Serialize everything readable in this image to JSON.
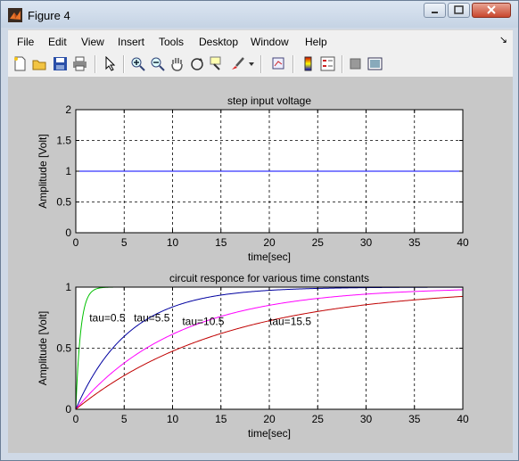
{
  "window": {
    "title": "Figure 4"
  },
  "menu": [
    "File",
    "Edit",
    "View",
    "Insert",
    "Tools",
    "Desktop",
    "Window",
    "Help"
  ],
  "toolbar_icons": [
    "new-figure-icon",
    "open-file-icon",
    "save-icon",
    "print-icon",
    "select-arrow-icon",
    "zoom-in-icon",
    "zoom-out-icon",
    "pan-hand-icon",
    "rotate-3d-icon",
    "data-cursor-icon",
    "brush-icon",
    "brush-dropdown-icon",
    "link-plot-icon",
    "colorbar-icon",
    "legend-icon",
    "hide-plot-tools-icon",
    "show-plot-tools-icon"
  ],
  "chart_data": [
    {
      "type": "line",
      "title": "step input voltage",
      "xlabel": "time[sec]",
      "ylabel": "Amplitude [Volt]",
      "xlim": [
        0,
        40
      ],
      "ylim": [
        0,
        2
      ],
      "xticks": [
        "0",
        "5",
        "10",
        "15",
        "20",
        "25",
        "30",
        "35",
        "40"
      ],
      "yticks": [
        "0",
        "0.5",
        "1",
        "1.5",
        "2"
      ],
      "grid": true,
      "series": [
        {
          "color": "#0000ff",
          "x": [
            0,
            40
          ],
          "y": [
            1,
            1
          ]
        }
      ]
    },
    {
      "type": "line",
      "title": "circuit responce for various time constants",
      "xlabel": "time[sec]",
      "ylabel": "Amplitude [Volt]",
      "xlim": [
        0,
        40
      ],
      "ylim": [
        0,
        1
      ],
      "xticks": [
        "0",
        "5",
        "10",
        "15",
        "20",
        "25",
        "30",
        "35",
        "40"
      ],
      "yticks": [
        "0",
        "0.5",
        "1"
      ],
      "grid": true,
      "series": [
        {
          "tau": 0.5,
          "color": "#00c000"
        },
        {
          "tau": 5.5,
          "color": "#0000a0"
        },
        {
          "tau": 10.5,
          "color": "#ff00ff"
        },
        {
          "tau": 15.5,
          "color": "#c00000"
        }
      ],
      "annotations": [
        {
          "text": "tau=0.5",
          "x": 1.4,
          "y": 0.75
        },
        {
          "text": "tau=5.5",
          "x": 6.0,
          "y": 0.75
        },
        {
          "text": "tau=10.5",
          "x": 11.0,
          "y": 0.72
        },
        {
          "text": "tau=15.5",
          "x": 20.0,
          "y": 0.72
        }
      ]
    }
  ]
}
